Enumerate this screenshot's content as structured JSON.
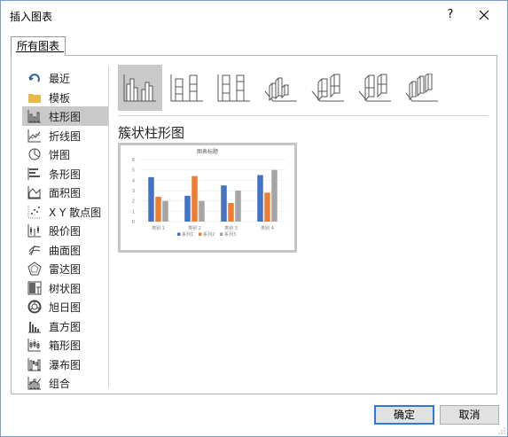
{
  "window": {
    "title": "插入图表",
    "help_label": "?",
    "close_label": "close"
  },
  "tabs": [
    {
      "label": "所有图表"
    }
  ],
  "sidebar": {
    "items": [
      {
        "label": "最近",
        "icon": "recent-icon"
      },
      {
        "label": "模板",
        "icon": "folder-icon"
      },
      {
        "label": "柱形图",
        "icon": "column-chart-icon",
        "selected": true
      },
      {
        "label": "折线图",
        "icon": "line-chart-icon"
      },
      {
        "label": "饼图",
        "icon": "pie-chart-icon"
      },
      {
        "label": "条形图",
        "icon": "bar-chart-icon"
      },
      {
        "label": "面积图",
        "icon": "area-chart-icon"
      },
      {
        "label": "X Y 散点图",
        "icon": "scatter-chart-icon"
      },
      {
        "label": "股价图",
        "icon": "stock-chart-icon"
      },
      {
        "label": "曲面图",
        "icon": "surface-chart-icon"
      },
      {
        "label": "雷达图",
        "icon": "radar-chart-icon"
      },
      {
        "label": "树状图",
        "icon": "treemap-chart-icon"
      },
      {
        "label": "旭日图",
        "icon": "sunburst-chart-icon"
      },
      {
        "label": "直方图",
        "icon": "histogram-chart-icon"
      },
      {
        "label": "箱形图",
        "icon": "box-whisker-chart-icon"
      },
      {
        "label": "瀑布图",
        "icon": "waterfall-chart-icon"
      },
      {
        "label": "组合",
        "icon": "combo-chart-icon"
      }
    ]
  },
  "chart_types": [
    {
      "icon": "clustered-column-icon",
      "selected": true
    },
    {
      "icon": "stacked-column-icon"
    },
    {
      "icon": "percent-stacked-column-icon"
    },
    {
      "icon": "3d-clustered-column-icon"
    },
    {
      "icon": "3d-stacked-column-icon"
    },
    {
      "icon": "3d-percent-stacked-column-icon"
    },
    {
      "icon": "3d-column-icon"
    }
  ],
  "main": {
    "subtitle": "簇状柱形图"
  },
  "chart_data": {
    "type": "bar",
    "title": "图表标题",
    "categories": [
      "类别 1",
      "类别 2",
      "类别 3",
      "类别 4"
    ],
    "series": [
      {
        "name": "系列1",
        "values": [
          4.3,
          2.5,
          3.5,
          4.5
        ],
        "color": "#4472c4"
      },
      {
        "name": "系列2",
        "values": [
          2.4,
          4.4,
          1.8,
          2.8
        ],
        "color": "#ed7d31"
      },
      {
        "name": "系列3",
        "values": [
          2.0,
          2.0,
          3.0,
          5.0
        ],
        "color": "#a5a5a5"
      }
    ],
    "ylim": [
      0,
      6
    ],
    "yticks": [
      "0",
      "1",
      "2",
      "3",
      "4",
      "5",
      "6"
    ],
    "grid": true,
    "legend_position": "bottom"
  },
  "buttons": {
    "ok_label": "确定",
    "cancel_label": "取消"
  }
}
